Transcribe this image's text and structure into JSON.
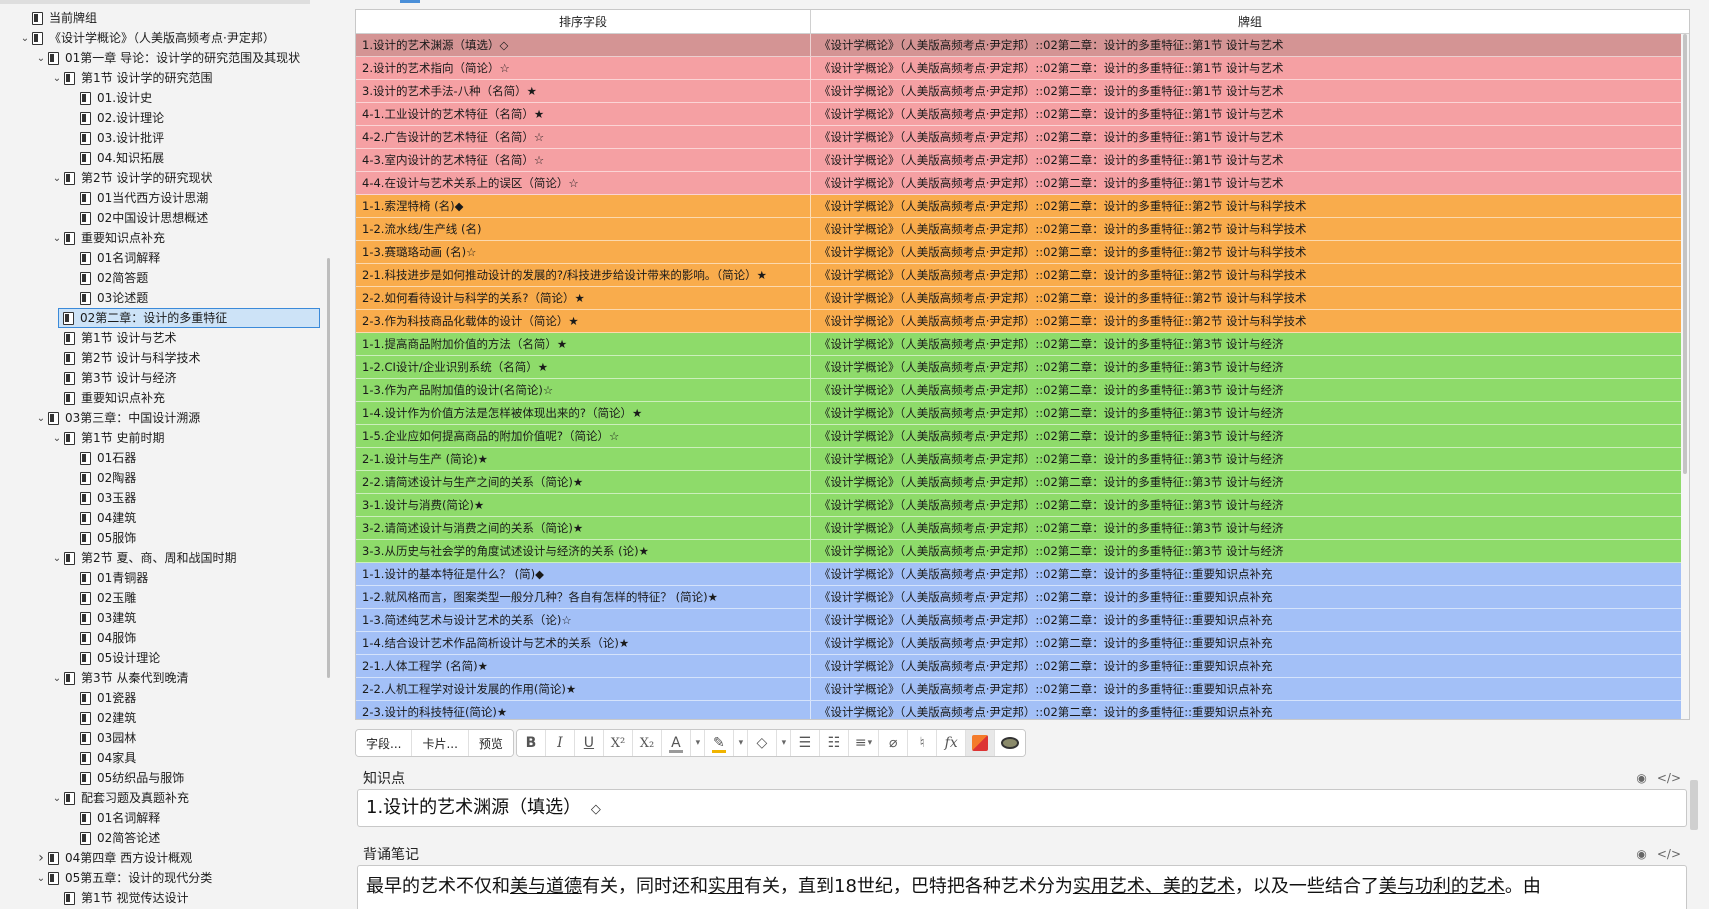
{
  "sidebar": {
    "items": [
      {
        "label": "当前牌组",
        "level": 0,
        "chev": "",
        "selected": false
      },
      {
        "label": "《设计学概论》（人美版高频考点·尹定邦）",
        "level": 0,
        "chev": "v",
        "selected": false
      },
      {
        "label": "01第一章 导论：设计学的研究范围及其现状",
        "level": 1,
        "chev": "v",
        "selected": false
      },
      {
        "label": "第1节 设计学的研究范围",
        "level": 2,
        "chev": "v",
        "selected": false
      },
      {
        "label": "01.设计史",
        "level": 3,
        "chev": "",
        "selected": false
      },
      {
        "label": "02.设计理论",
        "level": 3,
        "chev": "",
        "selected": false
      },
      {
        "label": "03.设计批评",
        "level": 3,
        "chev": "",
        "selected": false
      },
      {
        "label": "04.知识拓展",
        "level": 3,
        "chev": "",
        "selected": false
      },
      {
        "label": "第2节 设计学的研究现状",
        "level": 2,
        "chev": "v",
        "selected": false
      },
      {
        "label": "01当代西方设计思潮",
        "level": 3,
        "chev": "",
        "selected": false
      },
      {
        "label": "02中国设计思想概述",
        "level": 3,
        "chev": "",
        "selected": false
      },
      {
        "label": "重要知识点补充",
        "level": 2,
        "chev": "v",
        "selected": false
      },
      {
        "label": "01名词解释",
        "level": 3,
        "chev": "",
        "selected": false
      },
      {
        "label": "02简答题",
        "level": 3,
        "chev": "",
        "selected": false
      },
      {
        "label": "03论述题",
        "level": 3,
        "chev": "",
        "selected": false
      },
      {
        "label": "02第二章：设计的多重特征",
        "level": 1,
        "chev": "v",
        "selected": true
      },
      {
        "label": "第1节 设计与艺术",
        "level": 2,
        "chev": "",
        "selected": false
      },
      {
        "label": "第2节 设计与科学技术",
        "level": 2,
        "chev": "",
        "selected": false
      },
      {
        "label": "第3节 设计与经济",
        "level": 2,
        "chev": "",
        "selected": false
      },
      {
        "label": "重要知识点补充",
        "level": 2,
        "chev": "",
        "selected": false
      },
      {
        "label": "03第三章：中国设计溯源",
        "level": 1,
        "chev": "v",
        "selected": false
      },
      {
        "label": "第1节 史前时期",
        "level": 2,
        "chev": "v",
        "selected": false
      },
      {
        "label": "01石器",
        "level": 3,
        "chev": "",
        "selected": false
      },
      {
        "label": "02陶器",
        "level": 3,
        "chev": "",
        "selected": false
      },
      {
        "label": "03玉器",
        "level": 3,
        "chev": "",
        "selected": false
      },
      {
        "label": "04建筑",
        "level": 3,
        "chev": "",
        "selected": false
      },
      {
        "label": "05服饰",
        "level": 3,
        "chev": "",
        "selected": false
      },
      {
        "label": "第2节 夏、商、周和战国时期",
        "level": 2,
        "chev": "v",
        "selected": false
      },
      {
        "label": "01青铜器",
        "level": 3,
        "chev": "",
        "selected": false
      },
      {
        "label": "02玉雕",
        "level": 3,
        "chev": "",
        "selected": false
      },
      {
        "label": "03建筑",
        "level": 3,
        "chev": "",
        "selected": false
      },
      {
        "label": "04服饰",
        "level": 3,
        "chev": "",
        "selected": false
      },
      {
        "label": "05设计理论",
        "level": 3,
        "chev": "",
        "selected": false
      },
      {
        "label": "第3节 从秦代到晚清",
        "level": 2,
        "chev": "v",
        "selected": false
      },
      {
        "label": "01瓷器",
        "level": 3,
        "chev": "",
        "selected": false
      },
      {
        "label": "02建筑",
        "level": 3,
        "chev": "",
        "selected": false
      },
      {
        "label": "03园林",
        "level": 3,
        "chev": "",
        "selected": false
      },
      {
        "label": "04家具",
        "level": 3,
        "chev": "",
        "selected": false
      },
      {
        "label": "05纺织品与服饰",
        "level": 3,
        "chev": "",
        "selected": false
      },
      {
        "label": "配套习题及真题补充",
        "level": 2,
        "chev": "v",
        "selected": false
      },
      {
        "label": "01名词解释",
        "level": 3,
        "chev": "",
        "selected": false
      },
      {
        "label": "02简答论述",
        "level": 3,
        "chev": "",
        "selected": false
      },
      {
        "label": "04第四章 西方设计概观",
        "level": 1,
        "chev": ">",
        "selected": false
      },
      {
        "label": "05第五章：设计的现代分类",
        "level": 1,
        "chev": "v",
        "selected": false
      },
      {
        "label": "第1节 视觉传达设计",
        "level": 2,
        "chev": "",
        "selected": false
      }
    ]
  },
  "table": {
    "headers": {
      "sort": "排序字段",
      "deck": "牌组"
    },
    "colors": {
      "red1": "#d49494",
      "red": "#f5a0a3",
      "orange": "#f9ac4c",
      "green": "#8edb6a",
      "blue": "#a3c0f7"
    },
    "rows": [
      {
        "sort": "1.设计的艺术渊源（填选）◇",
        "deck": "《设计学概论》（人美版高频考点·尹定邦）::02第二章：设计的多重特征::第1节 设计与艺术",
        "color": "red1"
      },
      {
        "sort": "2.设计的艺术指向（简论）☆",
        "deck": "《设计学概论》（人美版高频考点·尹定邦）::02第二章：设计的多重特征::第1节 设计与艺术",
        "color": "red"
      },
      {
        "sort": "3.设计的艺术手法-八种（名简）★",
        "deck": "《设计学概论》（人美版高频考点·尹定邦）::02第二章：设计的多重特征::第1节 设计与艺术",
        "color": "red"
      },
      {
        "sort": "4-1.工业设计的艺术特征（名简）★",
        "deck": "《设计学概论》（人美版高频考点·尹定邦）::02第二章：设计的多重特征::第1节 设计与艺术",
        "color": "red"
      },
      {
        "sort": "4-2.广告设计的艺术特征（名简）☆",
        "deck": "《设计学概论》（人美版高频考点·尹定邦）::02第二章：设计的多重特征::第1节 设计与艺术",
        "color": "red"
      },
      {
        "sort": "4-3.室内设计的艺术特征（名简）☆",
        "deck": "《设计学概论》（人美版高频考点·尹定邦）::02第二章：设计的多重特征::第1节 设计与艺术",
        "color": "red"
      },
      {
        "sort": "4-4.在设计与艺术关系上的误区（简论）☆",
        "deck": "《设计学概论》（人美版高频考点·尹定邦）::02第二章：设计的多重特征::第1节 设计与艺术",
        "color": "red"
      },
      {
        "sort": "1-1.索涅特椅 (名)◆",
        "deck": "《设计学概论》（人美版高频考点·尹定邦）::02第二章：设计的多重特征::第2节 设计与科学技术",
        "color": "orange"
      },
      {
        "sort": "1-2.流水线/生产线 (名)",
        "deck": "《设计学概论》（人美版高频考点·尹定邦）::02第二章：设计的多重特征::第2节 设计与科学技术",
        "color": "orange"
      },
      {
        "sort": "1-3.赛璐珞动画 (名)☆",
        "deck": "《设计学概论》（人美版高频考点·尹定邦）::02第二章：设计的多重特征::第2节 设计与科学技术",
        "color": "orange"
      },
      {
        "sort": "2-1.科技进步是如何推动设计的发展的?/科技进步给设计带来的影响。（简论）★",
        "deck": "《设计学概论》（人美版高频考点·尹定邦）::02第二章：设计的多重特征::第2节 设计与科学技术",
        "color": "orange"
      },
      {
        "sort": "2-2.如何看待设计与科学的关系?（简论）★",
        "deck": "《设计学概论》（人美版高频考点·尹定邦）::02第二章：设计的多重特征::第2节 设计与科学技术",
        "color": "orange"
      },
      {
        "sort": "2-3.作为科技商品化载体的设计（简论）★",
        "deck": "《设计学概论》（人美版高频考点·尹定邦）::02第二章：设计的多重特征::第2节 设计与科学技术",
        "color": "orange"
      },
      {
        "sort": "1-1.提高商品附加价值的方法（名简）★",
        "deck": "《设计学概论》（人美版高频考点·尹定邦）::02第二章：设计的多重特征::第3节 设计与经济",
        "color": "green"
      },
      {
        "sort": "1-2.CI设计/企业识别系统（名简）★",
        "deck": "《设计学概论》（人美版高频考点·尹定邦）::02第二章：设计的多重特征::第3节 设计与经济",
        "color": "green"
      },
      {
        "sort": "1-3.作为产品附加值的设计(名简论)☆",
        "deck": "《设计学概论》（人美版高频考点·尹定邦）::02第二章：设计的多重特征::第3节 设计与经济",
        "color": "green"
      },
      {
        "sort": "1-4.设计作为价值方法是怎样被体现出来的?（简论）★",
        "deck": "《设计学概论》（人美版高频考点·尹定邦）::02第二章：设计的多重特征::第3节 设计与经济",
        "color": "green"
      },
      {
        "sort": "1-5.企业应如何提高商品的附加价值呢?（简论）☆",
        "deck": "《设计学概论》（人美版高频考点·尹定邦）::02第二章：设计的多重特征::第3节 设计与经济",
        "color": "green"
      },
      {
        "sort": "2-1.设计与生产 (简论)★",
        "deck": "《设计学概论》（人美版高频考点·尹定邦）::02第二章：设计的多重特征::第3节 设计与经济",
        "color": "green"
      },
      {
        "sort": "2-2.请简述设计与生产之间的关系（简论)★",
        "deck": "《设计学概论》（人美版高频考点·尹定邦）::02第二章：设计的多重特征::第3节 设计与经济",
        "color": "green"
      },
      {
        "sort": "3-1.设计与消费(简论)★",
        "deck": "《设计学概论》（人美版高频考点·尹定邦）::02第二章：设计的多重特征::第3节 设计与经济",
        "color": "green"
      },
      {
        "sort": "3-2.请简述设计与消费之间的关系（简论)★",
        "deck": "《设计学概论》（人美版高频考点·尹定邦）::02第二章：设计的多重特征::第3节 设计与经济",
        "color": "green"
      },
      {
        "sort": "3-3.从历史与社会学的角度试述设计与经济的关系 (论)★",
        "deck": "《设计学概论》（人美版高频考点·尹定邦）::02第二章：设计的多重特征::第3节 设计与经济",
        "color": "green"
      },
      {
        "sort": "1-1.设计的基本特征是什么？ (简)◆",
        "deck": "《设计学概论》（人美版高频考点·尹定邦）::02第二章：设计的多重特征::重要知识点补充",
        "color": "blue"
      },
      {
        "sort": "1-2.就风格而言，图案类型一般分几种？各自有怎样的特征？ (简论)★",
        "deck": "《设计学概论》（人美版高频考点·尹定邦）::02第二章：设计的多重特征::重要知识点补充",
        "color": "blue"
      },
      {
        "sort": "1-3.简述纯艺术与设计艺术的关系（论)☆",
        "deck": "《设计学概论》（人美版高频考点·尹定邦）::02第二章：设计的多重特征::重要知识点补充",
        "color": "blue"
      },
      {
        "sort": "1-4.结合设计艺术作品简析设计与艺术的关系（论)★",
        "deck": "《设计学概论》（人美版高频考点·尹定邦）::02第二章：设计的多重特征::重要知识点补充",
        "color": "blue"
      },
      {
        "sort": "2-1.人体工程学 (名简)★",
        "deck": "《设计学概论》（人美版高频考点·尹定邦）::02第二章：设计的多重特征::重要知识点补充",
        "color": "blue"
      },
      {
        "sort": "2-2.人机工程学对设计发展的作用(简论)★",
        "deck": "《设计学概论》（人美版高频考点·尹定邦）::02第二章：设计的多重特征::重要知识点补充",
        "color": "blue"
      },
      {
        "sort": "2-3.设计的科技特征(简论)★",
        "deck": "《设计学概论》（人美版高频考点·尹定邦）::02第二章：设计的多重特征::重要知识点补充",
        "color": "blue"
      }
    ]
  },
  "toolbar": {
    "fields_label": "字段...",
    "cards_label": "卡片...",
    "preview_label": "预览",
    "bold": "B",
    "italic": "I",
    "underline": "U",
    "superscript": "X²",
    "subscript": "X₂",
    "text_color": "A",
    "text_color_hex": "#9a9a9a",
    "highlight_hex": "#f0b400",
    "accent_hex": "#3b8ad9"
  },
  "editor": {
    "field1": {
      "name": "知识点",
      "value": "1.设计的艺术渊源（填选）",
      "suffix": "◇"
    },
    "field2": {
      "name": "背诵笔记",
      "segments": [
        {
          "t": "最早的艺术不仅和",
          "u": false
        },
        {
          "t": "美与道德",
          "u": true
        },
        {
          "t": "有关，同时还和",
          "u": false
        },
        {
          "t": "实用",
          "u": true
        },
        {
          "t": "有关，直到18世纪，巴特把各种艺术分为",
          "u": false
        },
        {
          "t": "实用艺术、美的艺术",
          "u": true
        },
        {
          "t": "，以及一些结合了",
          "u": false
        },
        {
          "t": "美与功利的艺术",
          "u": true
        },
        {
          "t": "。由",
          "u": false
        }
      ]
    }
  }
}
